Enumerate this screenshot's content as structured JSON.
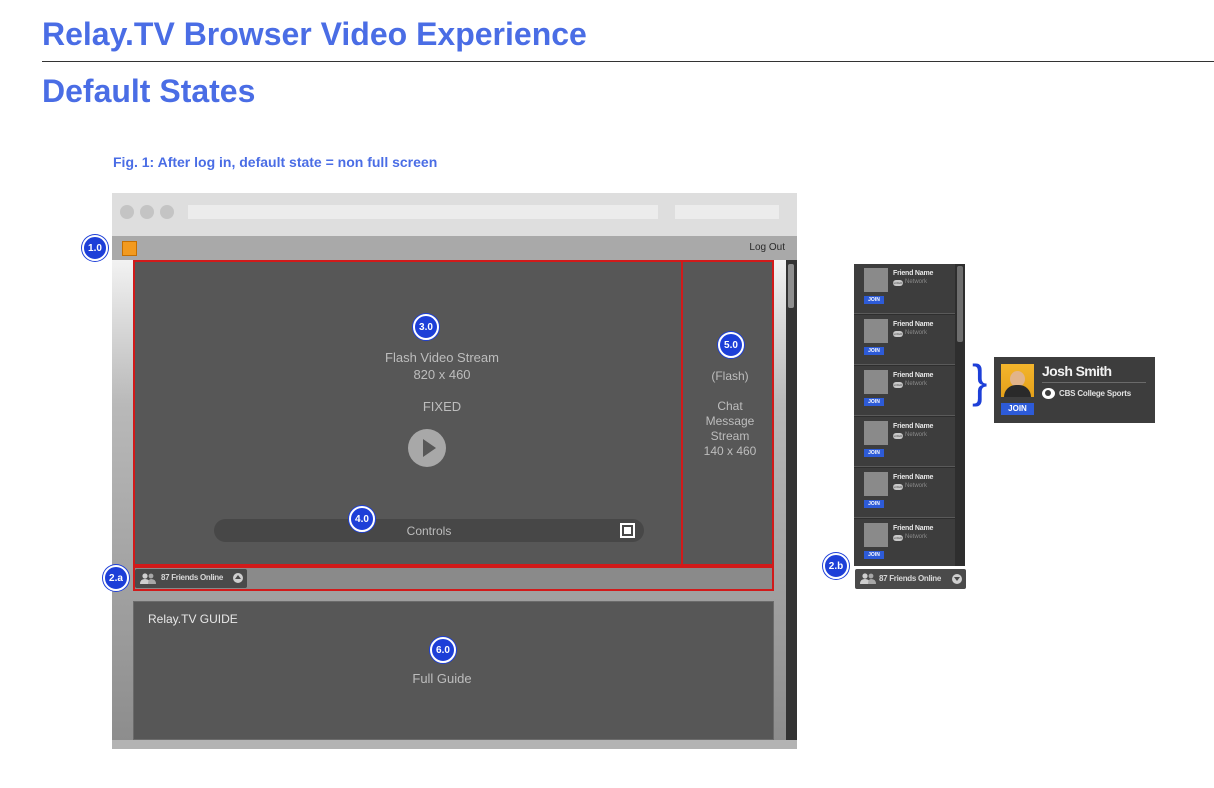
{
  "document": {
    "title": "Relay.TV Browser Video Experience",
    "subtitle": "Default States",
    "caption": "Fig. 1: After log in, default state = non full screen"
  },
  "browser": {
    "logout_label": "Log Out",
    "logo_color": "#f29a1f"
  },
  "player": {
    "stream_label": "Flash Video Stream",
    "size_label": "820 x 460",
    "fixed_label": "FIXED",
    "controls_label": "Controls",
    "play_icon": "play-icon",
    "fullscreen_icon": "fullscreen-icon"
  },
  "chat": {
    "type_label": "(Flash)",
    "line1": "Chat",
    "line2": "Message",
    "line3": "Stream",
    "size_label": "140 x 460"
  },
  "friends_strip": {
    "label": "87 Friends Online"
  },
  "guide": {
    "title": "Relay.TV GUIDE",
    "label": "Full Guide"
  },
  "badges": {
    "b1": "1.0",
    "b2a": "2.a",
    "b2b": "2.b",
    "b3": "3.0",
    "b4": "4.0",
    "b5": "5.0",
    "b6": "6.0"
  },
  "friends_panel": {
    "rows": [
      {
        "name": "Friend Name",
        "logo": "LOGO",
        "network": "Network",
        "join": "JOIN"
      },
      {
        "name": "Friend Name",
        "logo": "LOGO",
        "network": "Network",
        "join": "JOIN"
      },
      {
        "name": "Friend Name",
        "logo": "LOGO",
        "network": "Network",
        "join": "JOIN"
      },
      {
        "name": "Friend Name",
        "logo": "LOGO",
        "network": "Network",
        "join": "JOIN"
      },
      {
        "name": "Friend Name",
        "logo": "LOGO",
        "network": "Network",
        "join": "JOIN"
      },
      {
        "name": "Friend Name",
        "logo": "LOGO",
        "network": "Network",
        "join": "JOIN"
      }
    ],
    "footer_label": "87 Friends Online"
  },
  "detail_card": {
    "name": "Josh Smith",
    "network": "CBS College Sports",
    "join": "JOIN"
  },
  "colors": {
    "heading": "#4a6de5",
    "badge": "#1d3fd8",
    "highlight": "#d11a1a",
    "join": "#2d5bd8"
  }
}
